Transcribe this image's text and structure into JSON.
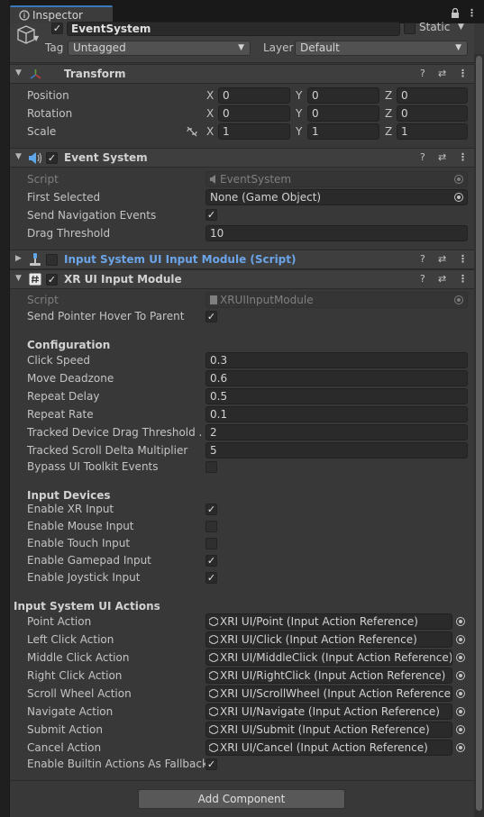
{
  "window": {
    "tab_label": "Inspector",
    "tab_icon": "info-icon"
  },
  "gameobject": {
    "name": "EventSystem",
    "active": true,
    "static_label": "Static",
    "tag_label": "Tag",
    "tag_value": "Untagged",
    "layer_label": "Layer",
    "layer_value": "Default"
  },
  "transform": {
    "title": "Transform",
    "rows": [
      {
        "label": "Position",
        "x": "0",
        "y": "0",
        "z": "0"
      },
      {
        "label": "Rotation",
        "x": "0",
        "y": "0",
        "z": "0"
      },
      {
        "label": "Scale",
        "x": "1",
        "y": "1",
        "z": "1"
      }
    ],
    "axes": [
      "X",
      "Y",
      "Z"
    ]
  },
  "event_system": {
    "title": "Event System",
    "enabled": true,
    "script_label": "Script",
    "script_value": "EventSystem",
    "first_selected_label": "First Selected",
    "first_selected_value": "None (Game Object)",
    "send_nav_label": "Send Navigation Events",
    "send_nav_checked": true,
    "drag_threshold_label": "Drag Threshold",
    "drag_threshold_value": "10"
  },
  "input_system_module": {
    "title": "Input System UI Input Module (Script)",
    "enabled": false
  },
  "xr_module": {
    "title": "XR UI Input Module",
    "enabled": true,
    "script_label": "Script",
    "script_value": "XRUIInputModule",
    "hover_label": "Send Pointer Hover To Parent",
    "hover_checked": true,
    "configuration_header": "Configuration",
    "config_rows": [
      {
        "label": "Click Speed",
        "value": "0.3"
      },
      {
        "label": "Move Deadzone",
        "value": "0.6"
      },
      {
        "label": "Repeat Delay",
        "value": "0.5"
      },
      {
        "label": "Repeat Rate",
        "value": "0.1"
      },
      {
        "label": "Tracked Device Drag Threshold ...",
        "value": "2"
      },
      {
        "label": "Tracked Scroll Delta Multiplier",
        "value": "5"
      }
    ],
    "bypass_label": "Bypass UI Toolkit Events",
    "bypass_checked": false,
    "input_devices_header": "Input Devices",
    "devices": [
      {
        "label": "Enable XR Input",
        "checked": true
      },
      {
        "label": "Enable Mouse Input",
        "checked": false
      },
      {
        "label": "Enable Touch Input",
        "checked": false
      },
      {
        "label": "Enable Gamepad Input",
        "checked": true
      },
      {
        "label": "Enable Joystick Input",
        "checked": true
      }
    ],
    "actions_header": "Input System UI Actions",
    "actions": [
      {
        "label": "Point Action",
        "value": "XRI UI/Point (Input Action Reference)"
      },
      {
        "label": "Left Click Action",
        "value": "XRI UI/Click (Input Action Reference)"
      },
      {
        "label": "Middle Click Action",
        "value": "XRI UI/MiddleClick (Input Action Reference)"
      },
      {
        "label": "Right Click Action",
        "value": "XRI UI/RightClick (Input Action Reference)"
      },
      {
        "label": "Scroll Wheel Action",
        "value": "XRI UI/ScrollWheel (Input Action Reference)"
      },
      {
        "label": "Navigate Action",
        "value": "XRI UI/Navigate (Input Action Reference)"
      },
      {
        "label": "Submit Action",
        "value": "XRI UI/Submit (Input Action Reference)"
      },
      {
        "label": "Cancel Action",
        "value": "XRI UI/Cancel (Input Action Reference)"
      }
    ],
    "fallback_label": "Enable Builtin Actions As Fallback",
    "fallback_checked": true
  },
  "add_component_label": "Add Component",
  "colors": {
    "accent": "#3a79bb",
    "link": "#6ba4e8",
    "panel": "#383838"
  }
}
